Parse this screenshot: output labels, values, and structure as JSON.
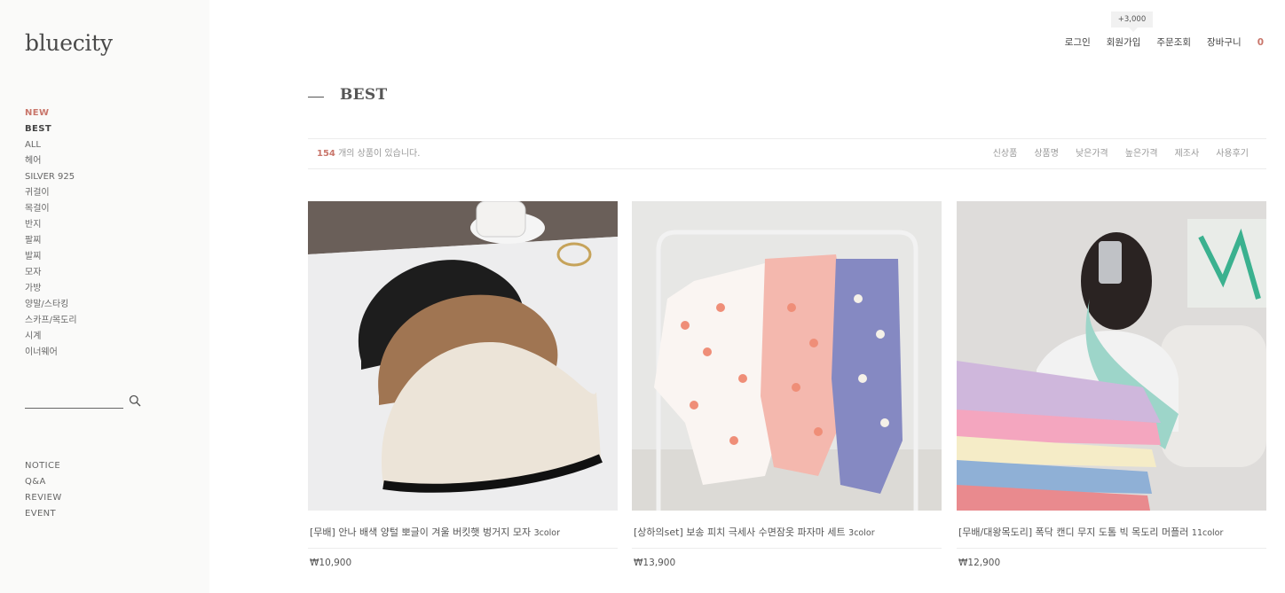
{
  "sidebar": {
    "logo": "bluecity",
    "categories": [
      "NEW",
      "BEST",
      "ALL",
      "헤어",
      "SILVER 925",
      "귀걸이",
      "목걸이",
      "반지",
      "팔찌",
      "발찌",
      "모자",
      "가방",
      "양말/스타킹",
      "스카프/목도리",
      "시계",
      "이너웨어"
    ],
    "search_placeholder": "",
    "board": [
      "NOTICE",
      "Q&A",
      "REVIEW",
      "EVENT"
    ]
  },
  "topnav": {
    "login": "로그인",
    "join": "회원가입",
    "order": "주문조회",
    "cart": "장바구니",
    "cart_count": "0",
    "point_badge": "+3,000"
  },
  "page": {
    "title": "BEST",
    "count": "154",
    "count_suffix": "개의 상품이 있습니다.",
    "sort": [
      "신상품",
      "상품명",
      "낮은가격",
      "높은가격",
      "제조사",
      "사용후기"
    ]
  },
  "products": [
    {
      "name": "[무배] 안나 배색 양털 뽀글이 겨울 버킷햇 벙거지 모자",
      "color": "3color",
      "price": "₩10,900"
    },
    {
      "name": "[상하의set] 보송 피치 극세사 수면잠옷 파자마 세트",
      "color": "3color",
      "price": "₩13,900"
    },
    {
      "name": "[무배/대왕목도리] 폭닥 캔디 무지 도톰 빅 목도리 머플러",
      "color": "11color",
      "price": "₩12,900"
    }
  ],
  "colors": {
    "accent": "#c9766b",
    "sidebar_bg": "#fafaf9"
  }
}
